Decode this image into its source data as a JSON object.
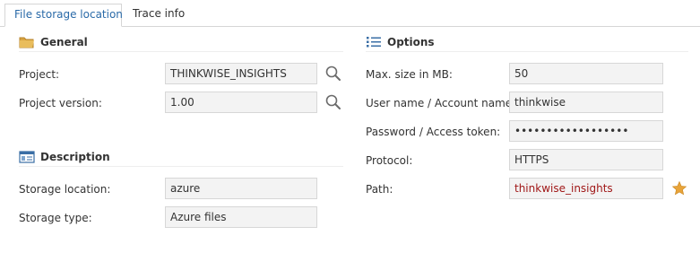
{
  "tabs": [
    {
      "label": "File storage location",
      "active": true
    },
    {
      "label": "Trace info",
      "active": false
    }
  ],
  "general": {
    "title": "General",
    "fields": [
      {
        "label": "Project:",
        "value": "THINKWISE_INSIGHTS"
      },
      {
        "label": "Project version:",
        "value": "1.00"
      }
    ]
  },
  "description": {
    "title": "Description",
    "fields": [
      {
        "label": "Storage location:",
        "value": "azure"
      },
      {
        "label": "Storage type:",
        "value": "Azure files"
      }
    ]
  },
  "options": {
    "title": "Options",
    "fields": [
      {
        "label": "Max. size in MB:",
        "value": "50"
      },
      {
        "label": "User name / Account name:",
        "value": "thinkwise"
      },
      {
        "label": "Password / Access token:",
        "value": "••••••••••••••••••"
      },
      {
        "label": "Protocol:",
        "value": "HTTPS"
      },
      {
        "label": "Path:",
        "value": "thinkwise_insights"
      }
    ]
  },
  "icons": {
    "general": "folder-icon",
    "description": "id-card-icon",
    "options": "list-icon",
    "lookup": "search-icon",
    "favorite": "star-icon"
  },
  "colors": {
    "active_tab_text": "#2a6aa8",
    "mandatory_text": "#a01818",
    "field_bg": "#f3f3f3",
    "star": "#e8a43a"
  }
}
